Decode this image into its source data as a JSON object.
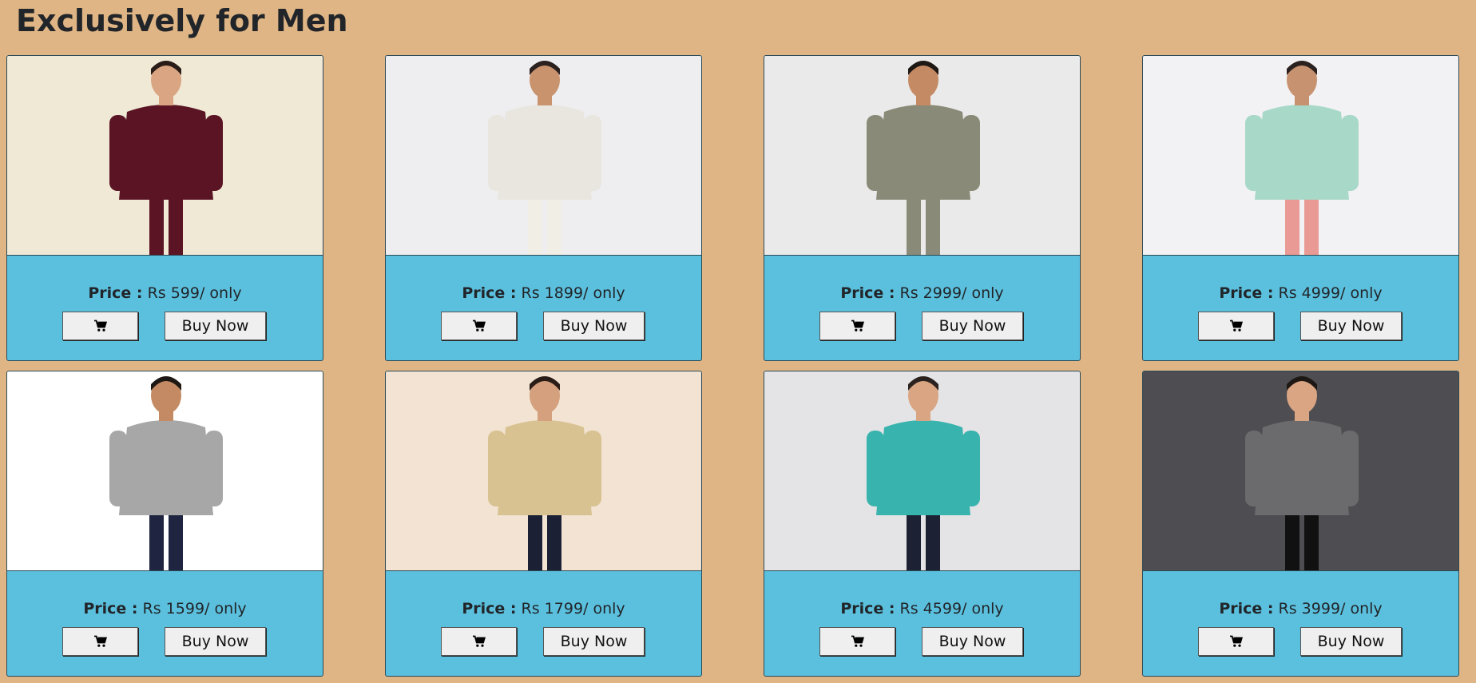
{
  "page": {
    "title": "Exclusively for Men"
  },
  "price_label": "Price :",
  "buy_label": "Buy Now",
  "products": [
    {
      "price": "Rs 599/ only",
      "bg": "#efe9d6",
      "garment": "#5a1424",
      "bottom": "#5a1424",
      "skin": "#d9a583",
      "hair": "#2a1d17"
    },
    {
      "price": "Rs 1899/ only",
      "bg": "#eeeef0",
      "garment": "#e8e6df",
      "bottom": "#f1eee6",
      "skin": "#c9936e",
      "hair": "#2b2220"
    },
    {
      "price": "Rs 2999/ only",
      "bg": "#eaeaea",
      "garment": "#8a8a78",
      "bottom": "#8a8a78",
      "skin": "#c48a63",
      "hair": "#1e1814"
    },
    {
      "price": "Rs 4999/ only",
      "bg": "#f2f2f4",
      "garment": "#a8d8c8",
      "bottom": "#e99a94",
      "skin": "#c79270",
      "hair": "#2b2220"
    },
    {
      "price": "Rs 1599/ only",
      "bg": "#ffffff",
      "garment": "#a7a7a7",
      "bottom": "#1f2440",
      "skin": "#c48a63",
      "hair": "#1e1814"
    },
    {
      "price": "Rs 1799/ only",
      "bg": "#f2e3d2",
      "garment": "#d8c291",
      "bottom": "#1b2034",
      "skin": "#d4a07d",
      "hair": "#2a1d17"
    },
    {
      "price": "Rs 4599/ only",
      "bg": "#e4e4e6",
      "garment": "#38b3ad",
      "bottom": "#1c2233",
      "skin": "#d9a583",
      "hair": "#2b2220"
    },
    {
      "price": "Rs 3999/ only",
      "bg": "#4e4e52",
      "garment": "#6b6b6d",
      "bottom": "#111111",
      "skin": "#d9a583",
      "hair": "#1e1814"
    }
  ]
}
